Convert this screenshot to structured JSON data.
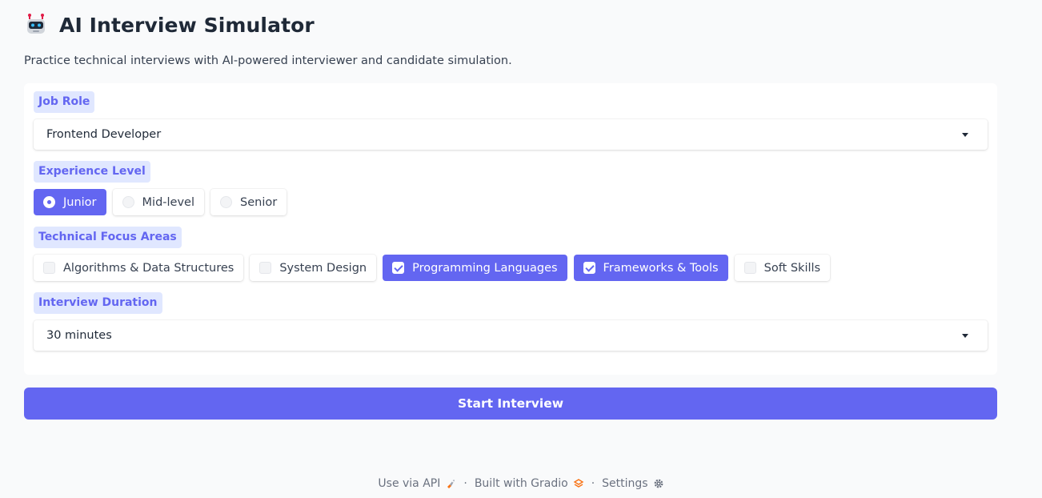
{
  "header": {
    "title": "AI Interview Simulator",
    "subtitle": "Practice technical interviews with AI-powered interviewer and candidate simulation.",
    "icon": "robot-icon"
  },
  "job_role": {
    "label": "Job Role",
    "value": "Frontend Developer"
  },
  "experience": {
    "label": "Experience Level",
    "options": [
      {
        "label": "Junior",
        "selected": true
      },
      {
        "label": "Mid-level",
        "selected": false
      },
      {
        "label": "Senior",
        "selected": false
      }
    ]
  },
  "focus": {
    "label": "Technical Focus Areas",
    "options": [
      {
        "label": "Algorithms & Data Structures",
        "checked": false
      },
      {
        "label": "System Design",
        "checked": false
      },
      {
        "label": "Programming Languages",
        "checked": true
      },
      {
        "label": "Frameworks & Tools",
        "checked": true
      },
      {
        "label": "Soft Skills",
        "checked": false
      }
    ]
  },
  "duration": {
    "label": "Interview Duration",
    "value": "30 minutes"
  },
  "start_button": "Start Interview",
  "footer": {
    "api": "Use via API",
    "built": "Built with Gradio",
    "settings": "Settings",
    "separator": "·"
  },
  "colors": {
    "accent": "#6366f1",
    "label_bg": "#e0e7ff"
  }
}
